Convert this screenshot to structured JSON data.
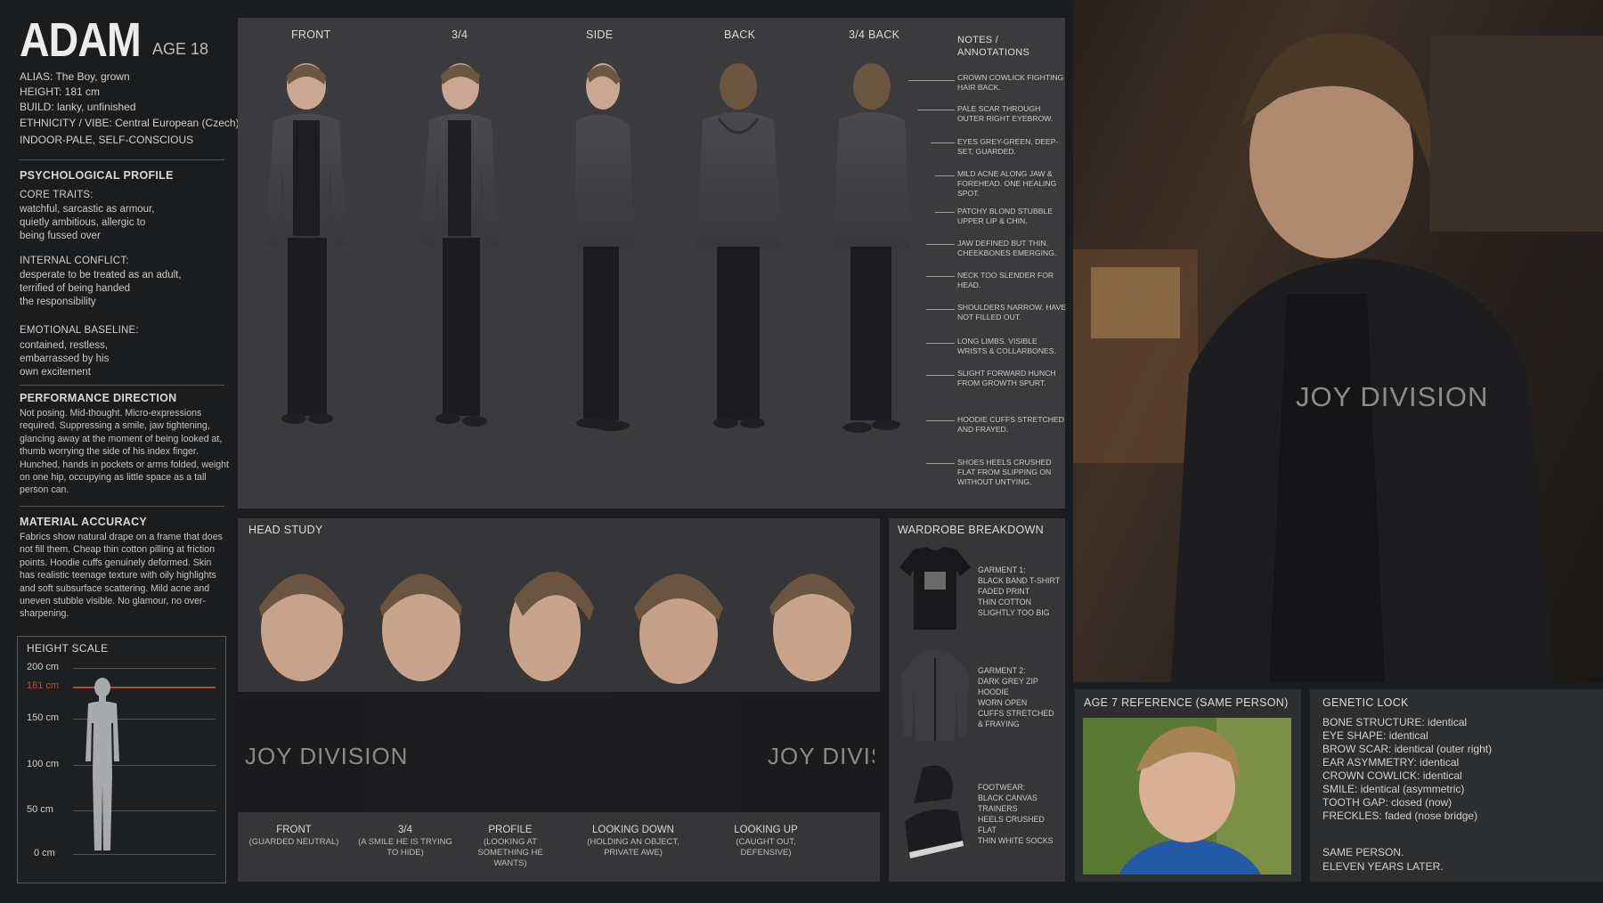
{
  "character": {
    "name": "ADAM",
    "age": "AGE 18",
    "id_lines": [
      "ALIAS: The Boy, grown",
      "HEIGHT: 181 cm",
      "BUILD: lanky, unfinished",
      "ETHNICITY / VIBE: Central European (Czech)",
      "INDOOR-PALE, SELF-CONSCIOUS"
    ]
  },
  "psych": {
    "title": "PSYCHOLOGICAL PROFILE",
    "core_title": "CORE TRAITS:",
    "core_text": "watchful, sarcastic as armour,\nquietly ambitious, allergic to\nbeing fussed over",
    "conflict_title": "INTERNAL CONFLICT:",
    "conflict_text": "desperate to be treated as an adult,\nterrified of being handed\nthe responsibility",
    "baseline_title": "EMOTIONAL BASELINE:",
    "baseline_text": "contained, restless,\nembarrassed by his\nown excitement"
  },
  "performance": {
    "title": "PERFORMANCE DIRECTION",
    "text": "Not posing. Mid-thought. Micro-expressions required. Suppressing a smile, jaw tightening, glancing away at the moment of being looked at, thumb worrying the side of his index finger. Hunched, hands in pockets or arms folded, weight on one hip, occupying as little space as a tall person can."
  },
  "material": {
    "title": "MATERIAL ACCURACY",
    "text": "Fabrics show natural drape on a frame that does not fill them. Cheap thin cotton pilling at friction points. Hoodie cuffs genuinely deformed. Skin has realistic teenage texture with oily highlights and soft subsurface scattering. Mild acne and uneven stubble visible. No glamour, no over-sharpening."
  },
  "height_scale": {
    "title": "HEIGHT SCALE",
    "ticks": [
      "200 cm",
      "181 cm",
      "150 cm",
      "100 cm",
      "50 cm",
      "0 cm"
    ],
    "subject_height_cm": 181
  },
  "turnaround": {
    "views": [
      "FRONT",
      "3/4",
      "SIDE",
      "BACK",
      "3/4 BACK"
    ],
    "notes_title": "NOTES / ANNOTATIONS",
    "notes": [
      "CROWN COWLICK FIGHTING HAIR BACK.",
      "PALE SCAR THROUGH OUTER RIGHT EYEBROW.",
      "EYES GREY-GREEN, DEEP-SET, GUARDED.",
      "MILD ACNE ALONG JAW & FOREHEAD. ONE HEALING SPOT.",
      "PATCHY BLOND STUBBLE UPPER LIP & CHIN.",
      "JAW DEFINED BUT THIN. CHEEKBONES EMERGING.",
      "NECK TOO SLENDER FOR HEAD.",
      "SHOULDERS NARROW. HAVE NOT FILLED OUT.",
      "LONG LIMBS. VISIBLE WRISTS & COLLARBONES.",
      "SLIGHT FORWARD HUNCH FROM GROWTH SPURT.",
      "HOODIE CUFFS STRETCHED AND FRAYED.",
      "SHOES HEELS CRUSHED FLAT FROM SLIPPING ON WITHOUT UNTYING."
    ]
  },
  "head_study": {
    "title": "HEAD STUDY",
    "shirt_print": "JOY DIVISION",
    "captions": [
      {
        "label": "FRONT",
        "sub": "(GUARDED NEUTRAL)"
      },
      {
        "label": "3/4",
        "sub": "(A SMILE HE IS TRYING TO HIDE)"
      },
      {
        "label": "PROFILE",
        "sub": "(LOOKING AT SOMETHING HE WANTS)"
      },
      {
        "label": "LOOKING DOWN",
        "sub": "(HOLDING AN OBJECT, PRIVATE AWE)"
      },
      {
        "label": "LOOKING UP",
        "sub": "(CAUGHT OUT, DEFENSIVE)"
      }
    ]
  },
  "wardrobe": {
    "title": "WARDROBE BREAKDOWN",
    "items": [
      "GARMENT 1:\nBLACK BAND T-SHIRT\nFADED PRINT\nTHIN COTTON\nSLIGHTLY TOO BIG",
      "GARMENT 2:\nDARK GREY ZIP HOODIE\nWORN OPEN\nCUFFS STRETCHED\n& FRAYING",
      "FOOTWEAR:\nBLACK CANVAS\nTRAINERS\nHEELS CRUSHED FLAT\nTHIN WHITE SOCKS"
    ]
  },
  "age7": {
    "title": "AGE 7 REFERENCE (SAME PERSON)"
  },
  "genetic_lock": {
    "title": "GENETIC LOCK",
    "lines": [
      {
        "k": "BONE STRUCTURE:",
        "v": "identical"
      },
      {
        "k": "EYE SHAPE:",
        "v": "identical"
      },
      {
        "k": "BROW SCAR:",
        "v": "identical (outer right)"
      },
      {
        "k": "EAR ASYMMETRY:",
        "v": "identical"
      },
      {
        "k": "CROWN COWLICK:",
        "v": "identical"
      },
      {
        "k": "SMILE:",
        "v": "identical (asymmetric)"
      },
      {
        "k": "TOOTH GAP:",
        "v": "closed (now)"
      },
      {
        "k": "FRECKLES:",
        "v": "faded (nose bridge)"
      }
    ],
    "closing": "SAME PERSON.\nELEVEN YEARS LATER."
  },
  "colors": {
    "background": "#1b1c1e",
    "panel": "#3b3b3d",
    "accent_red": "#b24a3f"
  }
}
